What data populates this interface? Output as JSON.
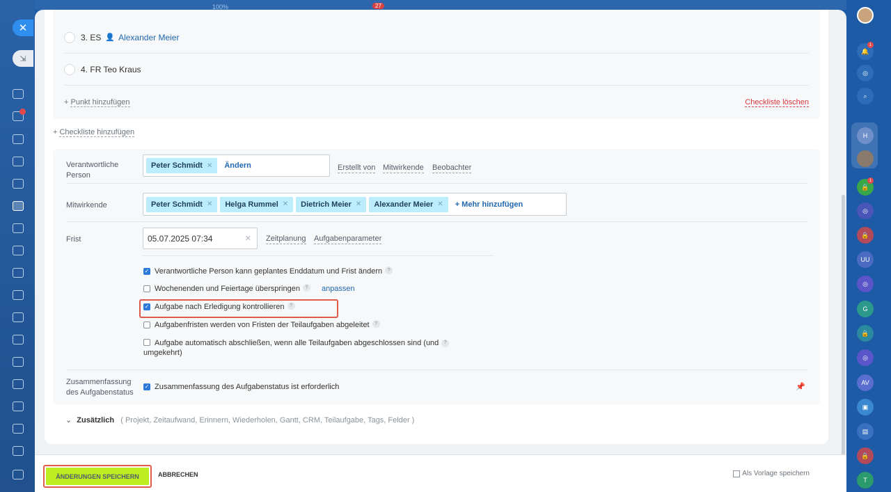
{
  "background": {
    "percent": "100%",
    "count": "27"
  },
  "checklist": {
    "items": [
      {
        "number": "3.",
        "text": "ES",
        "person": "Alexander Meier"
      },
      {
        "number": "4.",
        "text": "FR Teo Kraus",
        "person": ""
      }
    ],
    "add_point": "Punkt hinzufügen",
    "delete": "Checkliste löschen"
  },
  "add_checklist": "Checkliste hinzufügen",
  "form": {
    "responsible": {
      "label": "Verantwortliche Person",
      "chips": [
        "Peter Schmidt"
      ],
      "change": "Ändern",
      "tabs": [
        "Erstellt von",
        "Mitwirkende",
        "Beobachter"
      ]
    },
    "participants": {
      "label": "Mitwirkende",
      "chips": [
        "Peter Schmidt",
        "Helga Rummel",
        "Dietrich Meier",
        "Alexander Meier"
      ],
      "add_more": "+ Mehr hinzufügen"
    },
    "deadline": {
      "label": "Frist",
      "value": "05.07.2025 07:34",
      "links": [
        "Zeitplanung",
        "Aufgabenparameter"
      ]
    },
    "options": [
      {
        "text": "Verantwortliche Person kann geplantes Enddatum und Frist ändern",
        "checked": true,
        "help": true
      },
      {
        "text": "Wochenenden und Feiertage überspringen",
        "checked": false,
        "help": true,
        "link": "anpassen"
      },
      {
        "text": "Aufgabe nach Erledigung kontrollieren",
        "checked": true,
        "help": true
      },
      {
        "text": "Aufgabenfristen werden von Fristen der Teilaufgaben abgeleitet",
        "checked": false,
        "help": true
      },
      {
        "text": "Aufgabe automatisch abschließen, wenn alle Teilaufgaben abgeschlossen sind (und",
        "text2": "umgekehrt)",
        "checked": false,
        "help": true
      }
    ],
    "summary": {
      "label_line1": "Zusammenfassung",
      "label_line2": "des Aufgabenstatus",
      "text": "Zusammenfassung des Aufgabenstatus ist erforderlich",
      "checked": true
    }
  },
  "more": {
    "label": "Zusätzlich",
    "items": "( Projekt,  Zeitaufwand,  Erinnern,  Wiederholen,  Gantt,  CRM,  Teilaufgabe,  Tags,  Felder )"
  },
  "footer": {
    "save": "ÄNDERUNGEN SPEICHERN",
    "cancel": "ABBRECHEN",
    "template": "Als Vorlage speichern"
  },
  "right_bar": {
    "notifications_badge": "1",
    "lock_badge": "1",
    "avatars": [
      "H",
      "UU",
      "G",
      "AV",
      "T"
    ]
  },
  "left_bar": {
    "chat_badge": "1"
  },
  "colors": {
    "accent": "#2067b0",
    "save_button": "#bbed21",
    "highlight": "#e05a4c",
    "chip": "#bcedfc"
  }
}
